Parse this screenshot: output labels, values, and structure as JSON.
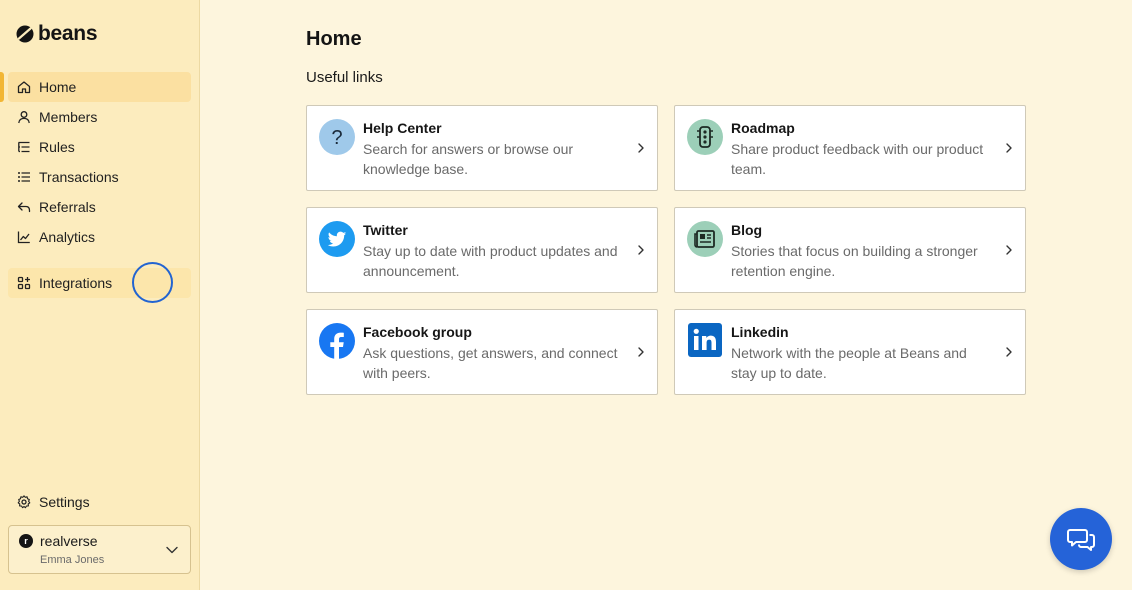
{
  "brand": {
    "name": "beans"
  },
  "sidebar": {
    "items": [
      {
        "label": "Home",
        "icon": "home-icon",
        "active": true
      },
      {
        "label": "Members",
        "icon": "user-icon"
      },
      {
        "label": "Rules",
        "icon": "rules-icon"
      },
      {
        "label": "Transactions",
        "icon": "list-icon"
      },
      {
        "label": "Referrals",
        "icon": "reply-arrow-icon"
      },
      {
        "label": "Analytics",
        "icon": "chart-line-icon"
      }
    ],
    "integrations": {
      "label": "Integrations",
      "icon": "apps-grid-icon"
    },
    "settings": {
      "label": "Settings",
      "icon": "gear-icon"
    },
    "org": {
      "initial": "r",
      "name": "realverse",
      "user": "Emma Jones"
    }
  },
  "main": {
    "title": "Home",
    "section_title": "Useful links",
    "cards": [
      {
        "title": "Help Center",
        "description": "Search for answers or browse our knowledge base.",
        "icon": "question-icon",
        "icon_bg": "#9fc9ea"
      },
      {
        "title": "Roadmap",
        "description": "Share product feedback with our product team.",
        "icon": "traffic-light-icon",
        "icon_bg": "#9ccfb8"
      },
      {
        "title": "Twitter",
        "description": "Stay up to date with product updates and announcement.",
        "icon": "twitter-icon",
        "icon_bg": "#1d9bf0"
      },
      {
        "title": "Blog",
        "description": "Stories that focus on building a stronger retention engine.",
        "icon": "newspaper-icon",
        "icon_bg": "#9ccfb8"
      },
      {
        "title": "Facebook group",
        "description": "Ask questions, get answers, and connect with peers.",
        "icon": "facebook-icon",
        "icon_bg": "#1877f2"
      },
      {
        "title": "Linkedin",
        "description": "Network with the people at Beans and stay up to date.",
        "icon": "linkedin-icon",
        "icon_bg": "#0a66c2"
      }
    ]
  },
  "chat": {
    "icon": "chat-bubbles-icon"
  },
  "colors": {
    "accent": "#f2b634",
    "sidebar_bg": "#fcecbe",
    "page_bg": "#fdf5dd",
    "chat_button": "#2563d8"
  }
}
